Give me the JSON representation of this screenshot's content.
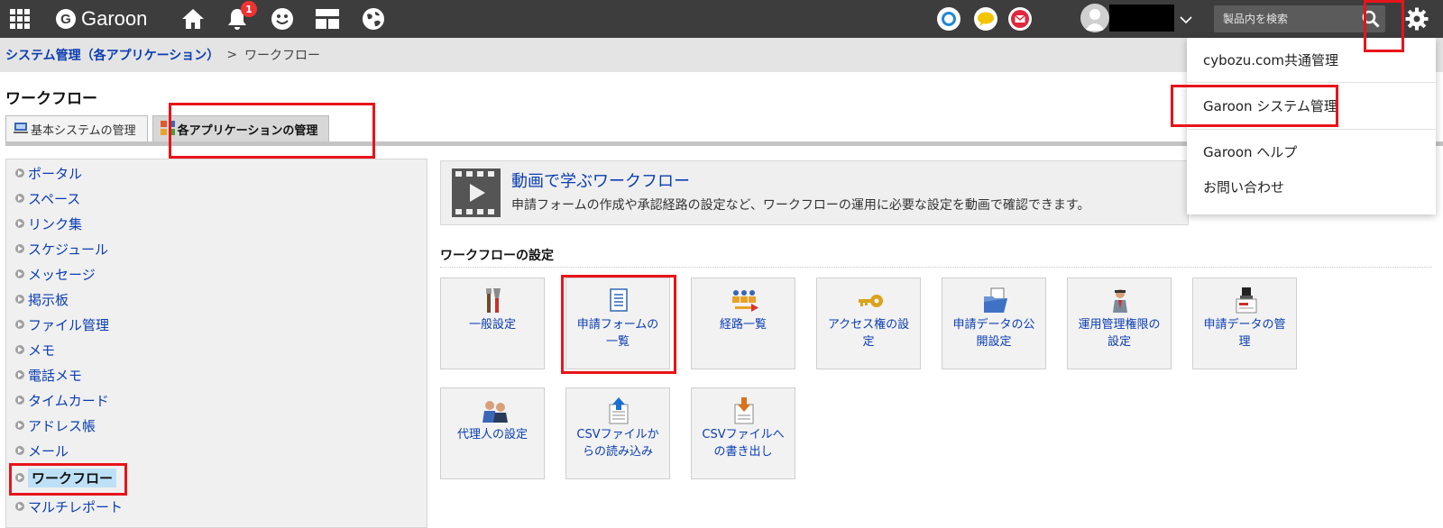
{
  "topbar": {
    "logo_text": "Garoon",
    "logo_letter": "G",
    "notification_count": "1",
    "search_placeholder": "製品内を検索",
    "icons": [
      "apps-grid-icon",
      "home-icon",
      "bell-icon",
      "smiley-icon",
      "portlet-icon",
      "globe-icon",
      "blue-ring-icon",
      "yellow-chat-icon",
      "mail-icon",
      "user-avatar-icon",
      "chevron-down-icon",
      "search-icon",
      "gear-icon"
    ]
  },
  "breadcrumb": {
    "parent": "システム管理（各アプリケーション）",
    "separator": ">",
    "current": "ワークフロー"
  },
  "page_title": "ワークフロー",
  "tabs": [
    {
      "label": "基本システムの管理",
      "active": false
    },
    {
      "label": "各アプリケーションの管理",
      "active": true
    }
  ],
  "sidebar": {
    "items": [
      {
        "label": "ポータル"
      },
      {
        "label": "スペース"
      },
      {
        "label": "リンク集"
      },
      {
        "label": "スケジュール"
      },
      {
        "label": "メッセージ"
      },
      {
        "label": "掲示板"
      },
      {
        "label": "ファイル管理"
      },
      {
        "label": "メモ"
      },
      {
        "label": "電話メモ"
      },
      {
        "label": "タイムカード"
      },
      {
        "label": "アドレス帳"
      },
      {
        "label": "メール"
      },
      {
        "label": "ワークフロー",
        "selected": true
      },
      {
        "label": "マルチレポート"
      }
    ]
  },
  "video": {
    "title": "動画で学ぶワークフロー",
    "description": "申請フォームの作成や承認経路の設定など、ワークフローの運用に必要な設定を動画で確認できます。"
  },
  "section_title": "ワークフローの設定",
  "cards": [
    {
      "line1": "一般設定",
      "line2": "",
      "icon": "tools-icon"
    },
    {
      "line1": "申請フォームの",
      "line2": "一覧",
      "icon": "form-list-icon"
    },
    {
      "line1": "経路一覧",
      "line2": "",
      "icon": "route-icon"
    },
    {
      "line1": "アクセス権の設",
      "line2": "定",
      "icon": "key-icon"
    },
    {
      "line1": "申請データの公",
      "line2": "開設定",
      "icon": "folder-icon"
    },
    {
      "line1": "運用管理権限の",
      "line2": "設定",
      "icon": "admin-icon"
    },
    {
      "line1": "申請データの管",
      "line2": "理",
      "icon": "stamp-icon"
    },
    {
      "line1": "代理人の設定",
      "line2": "",
      "icon": "proxy-icon"
    },
    {
      "line1": "CSVファイルか",
      "line2": "らの読み込み",
      "icon": "csv-import-icon"
    },
    {
      "line1": "CSVファイルへ",
      "line2": "の書き出し",
      "icon": "csv-export-icon"
    }
  ],
  "dropdown": {
    "items": [
      {
        "label": "cybozu.com共通管理"
      },
      {
        "label": "Garoon システム管理"
      },
      {
        "label": "Garoon ヘルプ"
      },
      {
        "label": "お問い合わせ"
      }
    ]
  },
  "colors": {
    "topbar": "#3d3d3d",
    "link": "#0b3db1",
    "highlight": "#e8141b",
    "selected_bg": "#bde0f7"
  }
}
